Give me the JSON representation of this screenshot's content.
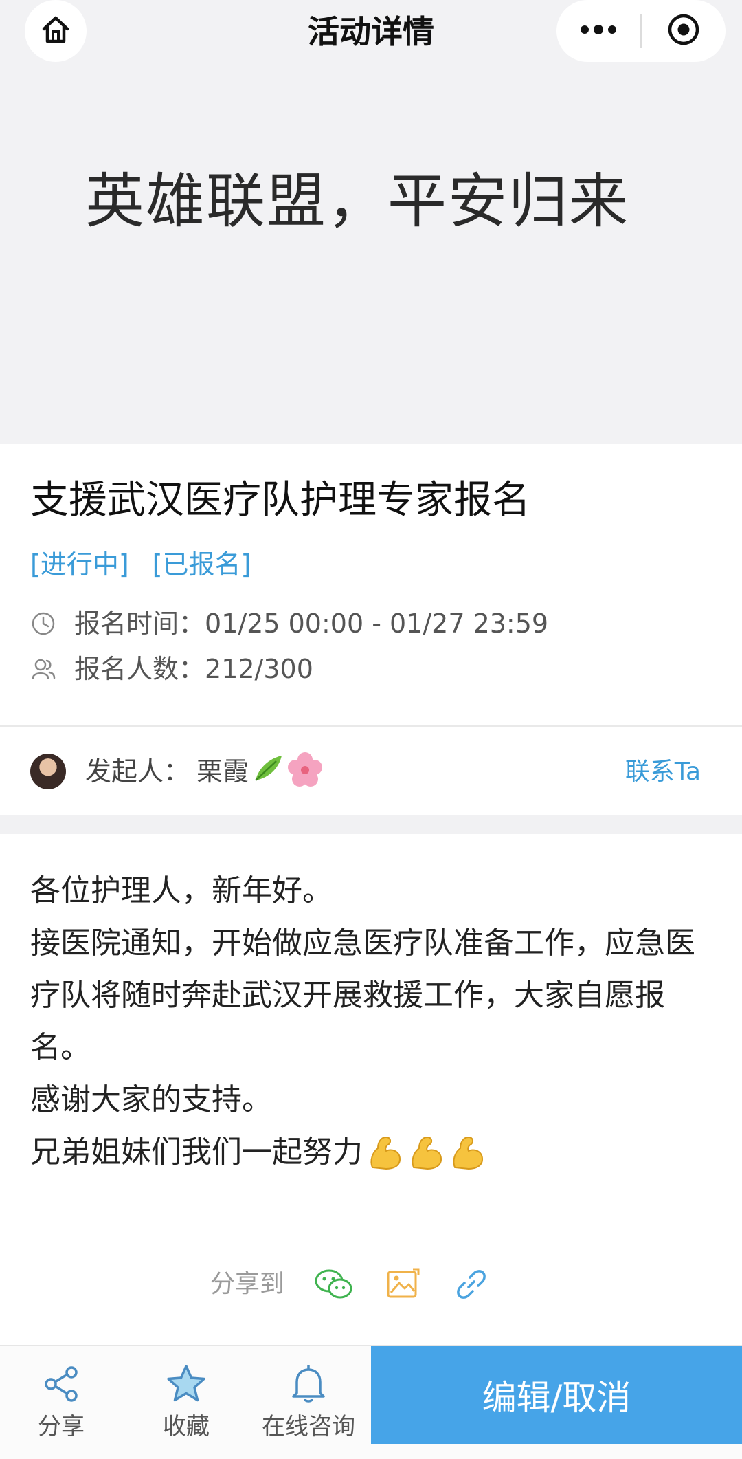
{
  "nav": {
    "title": "活动详情",
    "home_icon": "home-icon",
    "more_icon": "more-dots-icon",
    "close_icon": "target-close-icon"
  },
  "banner": {
    "text": "英雄联盟，平安归来"
  },
  "activity": {
    "title": "支援武汉医疗队护理专家报名",
    "status_active": "[进行中]",
    "status_registered": "[已报名]",
    "time_label": "报名时间：",
    "time_value": "01/25 00:00 - 01/27 23:59",
    "count_label": "报名人数：",
    "count_value": "212/300"
  },
  "organizer": {
    "label": "发起人：",
    "name": "栗霞",
    "contact": "联系Ta"
  },
  "description": {
    "line1": "各位护理人，新年好。",
    "line2": "接医院通知，开始做应急医疗队准备工作，应急医疗队将随时奔赴武汉开展救援工作，大家自愿报名。",
    "line3": "感谢大家的支持。",
    "line4": "兄弟姐妹们我们一起努力"
  },
  "share": {
    "label": "分享到",
    "icons": [
      "wechat-icon",
      "image-icon",
      "link-icon"
    ]
  },
  "bottom_bar": {
    "share_label": "分享",
    "favorite_label": "收藏",
    "consult_label": "在线咨询",
    "action_label": "编辑/取消"
  },
  "colors": {
    "accent": "#3a9bd8",
    "cta": "#46a4e8",
    "banner_bg": "#f2f2f4"
  }
}
